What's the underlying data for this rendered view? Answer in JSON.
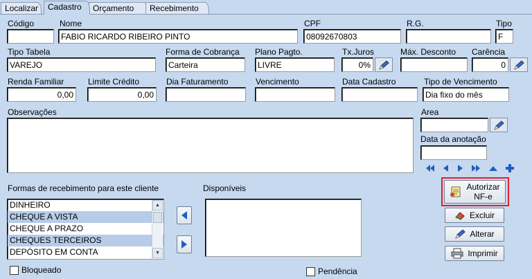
{
  "tabs": [
    "Localizar",
    "Cadastro",
    "Orçamento",
    "Recebimento"
  ],
  "labels": {
    "codigo": "Código",
    "nome": "Nome",
    "cpf": "CPF",
    "rg": "R.G.",
    "tipo": "Tipo",
    "tipo_tabela": "Tipo Tabela",
    "forma_cobranca": "Forma de Cobrança",
    "plano_pagto": "Plano Pagto.",
    "tx_juros": "Tx.Juros",
    "max_desconto": "Máx. Desconto",
    "carencia": "Carência",
    "renda_familiar": "Renda Familiar",
    "limite_credito": "Limite Crédito",
    "dia_faturamento": "Dia Faturamento",
    "vencimento": "Vencimento",
    "data_cadastro": "Data Cadastro",
    "tipo_vencimento": "Tipo de Vencimento",
    "observacoes": "Observações",
    "area": "Area",
    "data_anotacao": "Data da anotação",
    "formas_recebimento": "Formas de recebimento para este cliente",
    "disponiveis": "Disponíveis"
  },
  "values": {
    "codigo": "",
    "nome": "FABIO RICARDO RIBEIRO PINTO",
    "cpf": "08092670803",
    "rg": "",
    "tipo": "F",
    "tipo_tabela": "VAREJO",
    "forma_cobranca": "Carteira",
    "plano_pagto": "LIVRE",
    "tx_juros": "0%",
    "max_desconto": "",
    "carencia": "0",
    "renda_familiar": "0,00",
    "limite_credito": "0,00",
    "dia_faturamento": "",
    "vencimento": "",
    "data_cadastro": "",
    "tipo_vencimento": "Dia fixo do mês",
    "area": "",
    "data_anotacao": ""
  },
  "formas_list": [
    {
      "label": "DINHEIRO",
      "selected": false
    },
    {
      "label": "CHEQUE A VISTA",
      "selected": true
    },
    {
      "label": "CHEQUE A PRAZO",
      "selected": false
    },
    {
      "label": "CHEQUES TERCEIROS",
      "selected": true
    },
    {
      "label": "DEPÓSITO EM CONTA",
      "selected": false
    }
  ],
  "buttons": {
    "autorizar_line1": "Autorizar",
    "autorizar_line2": "NF-e",
    "excluir": "Excluir",
    "alterar": "Alterar",
    "imprimir": "Imprimir"
  },
  "checkboxes": {
    "bloqueado": "Bloqueado",
    "pendencia": "Pendência"
  },
  "colors": {
    "background": "#c6d9ef",
    "highlight": "#e0202c",
    "selection": "#b6cce8",
    "nav_arrows": "#1f5fbf"
  }
}
